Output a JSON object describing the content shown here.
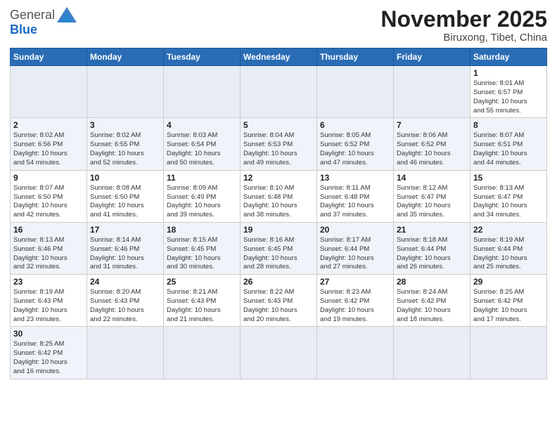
{
  "logo": {
    "general": "General",
    "blue": "Blue"
  },
  "title": {
    "month_year": "November 2025",
    "location": "Biruxong, Tibet, China"
  },
  "weekdays": [
    "Sunday",
    "Monday",
    "Tuesday",
    "Wednesday",
    "Thursday",
    "Friday",
    "Saturday"
  ],
  "weeks": [
    [
      {
        "day": "",
        "info": ""
      },
      {
        "day": "",
        "info": ""
      },
      {
        "day": "",
        "info": ""
      },
      {
        "day": "",
        "info": ""
      },
      {
        "day": "",
        "info": ""
      },
      {
        "day": "",
        "info": ""
      },
      {
        "day": "1",
        "info": "Sunrise: 8:01 AM\nSunset: 6:57 PM\nDaylight: 10 hours\nand 55 minutes."
      }
    ],
    [
      {
        "day": "2",
        "info": "Sunrise: 8:02 AM\nSunset: 6:56 PM\nDaylight: 10 hours\nand 54 minutes."
      },
      {
        "day": "3",
        "info": "Sunrise: 8:02 AM\nSunset: 6:55 PM\nDaylight: 10 hours\nand 52 minutes."
      },
      {
        "day": "4",
        "info": "Sunrise: 8:03 AM\nSunset: 6:54 PM\nDaylight: 10 hours\nand 50 minutes."
      },
      {
        "day": "5",
        "info": "Sunrise: 8:04 AM\nSunset: 6:53 PM\nDaylight: 10 hours\nand 49 minutes."
      },
      {
        "day": "6",
        "info": "Sunrise: 8:05 AM\nSunset: 6:52 PM\nDaylight: 10 hours\nand 47 minutes."
      },
      {
        "day": "7",
        "info": "Sunrise: 8:06 AM\nSunset: 6:52 PM\nDaylight: 10 hours\nand 46 minutes."
      },
      {
        "day": "8",
        "info": "Sunrise: 8:07 AM\nSunset: 6:51 PM\nDaylight: 10 hours\nand 44 minutes."
      }
    ],
    [
      {
        "day": "9",
        "info": "Sunrise: 8:07 AM\nSunset: 6:50 PM\nDaylight: 10 hours\nand 42 minutes."
      },
      {
        "day": "10",
        "info": "Sunrise: 8:08 AM\nSunset: 6:50 PM\nDaylight: 10 hours\nand 41 minutes."
      },
      {
        "day": "11",
        "info": "Sunrise: 8:09 AM\nSunset: 6:49 PM\nDaylight: 10 hours\nand 39 minutes."
      },
      {
        "day": "12",
        "info": "Sunrise: 8:10 AM\nSunset: 6:48 PM\nDaylight: 10 hours\nand 38 minutes."
      },
      {
        "day": "13",
        "info": "Sunrise: 8:11 AM\nSunset: 6:48 PM\nDaylight: 10 hours\nand 37 minutes."
      },
      {
        "day": "14",
        "info": "Sunrise: 8:12 AM\nSunset: 6:47 PM\nDaylight: 10 hours\nand 35 minutes."
      },
      {
        "day": "15",
        "info": "Sunrise: 8:13 AM\nSunset: 6:47 PM\nDaylight: 10 hours\nand 34 minutes."
      }
    ],
    [
      {
        "day": "16",
        "info": "Sunrise: 8:13 AM\nSunset: 6:46 PM\nDaylight: 10 hours\nand 32 minutes."
      },
      {
        "day": "17",
        "info": "Sunrise: 8:14 AM\nSunset: 6:46 PM\nDaylight: 10 hours\nand 31 minutes."
      },
      {
        "day": "18",
        "info": "Sunrise: 8:15 AM\nSunset: 6:45 PM\nDaylight: 10 hours\nand 30 minutes."
      },
      {
        "day": "19",
        "info": "Sunrise: 8:16 AM\nSunset: 6:45 PM\nDaylight: 10 hours\nand 28 minutes."
      },
      {
        "day": "20",
        "info": "Sunrise: 8:17 AM\nSunset: 6:44 PM\nDaylight: 10 hours\nand 27 minutes."
      },
      {
        "day": "21",
        "info": "Sunrise: 8:18 AM\nSunset: 6:44 PM\nDaylight: 10 hours\nand 26 minutes."
      },
      {
        "day": "22",
        "info": "Sunrise: 8:19 AM\nSunset: 6:44 PM\nDaylight: 10 hours\nand 25 minutes."
      }
    ],
    [
      {
        "day": "23",
        "info": "Sunrise: 8:19 AM\nSunset: 6:43 PM\nDaylight: 10 hours\nand 23 minutes."
      },
      {
        "day": "24",
        "info": "Sunrise: 8:20 AM\nSunset: 6:43 PM\nDaylight: 10 hours\nand 22 minutes."
      },
      {
        "day": "25",
        "info": "Sunrise: 8:21 AM\nSunset: 6:43 PM\nDaylight: 10 hours\nand 21 minutes."
      },
      {
        "day": "26",
        "info": "Sunrise: 8:22 AM\nSunset: 6:43 PM\nDaylight: 10 hours\nand 20 minutes."
      },
      {
        "day": "27",
        "info": "Sunrise: 8:23 AM\nSunset: 6:42 PM\nDaylight: 10 hours\nand 19 minutes."
      },
      {
        "day": "28",
        "info": "Sunrise: 8:24 AM\nSunset: 6:42 PM\nDaylight: 10 hours\nand 18 minutes."
      },
      {
        "day": "29",
        "info": "Sunrise: 8:25 AM\nSunset: 6:42 PM\nDaylight: 10 hours\nand 17 minutes."
      }
    ],
    [
      {
        "day": "30",
        "info": "Sunrise: 8:25 AM\nSunset: 6:42 PM\nDaylight: 10 hours\nand 16 minutes."
      },
      {
        "day": "",
        "info": ""
      },
      {
        "day": "",
        "info": ""
      },
      {
        "day": "",
        "info": ""
      },
      {
        "day": "",
        "info": ""
      },
      {
        "day": "",
        "info": ""
      },
      {
        "day": "",
        "info": ""
      }
    ]
  ]
}
